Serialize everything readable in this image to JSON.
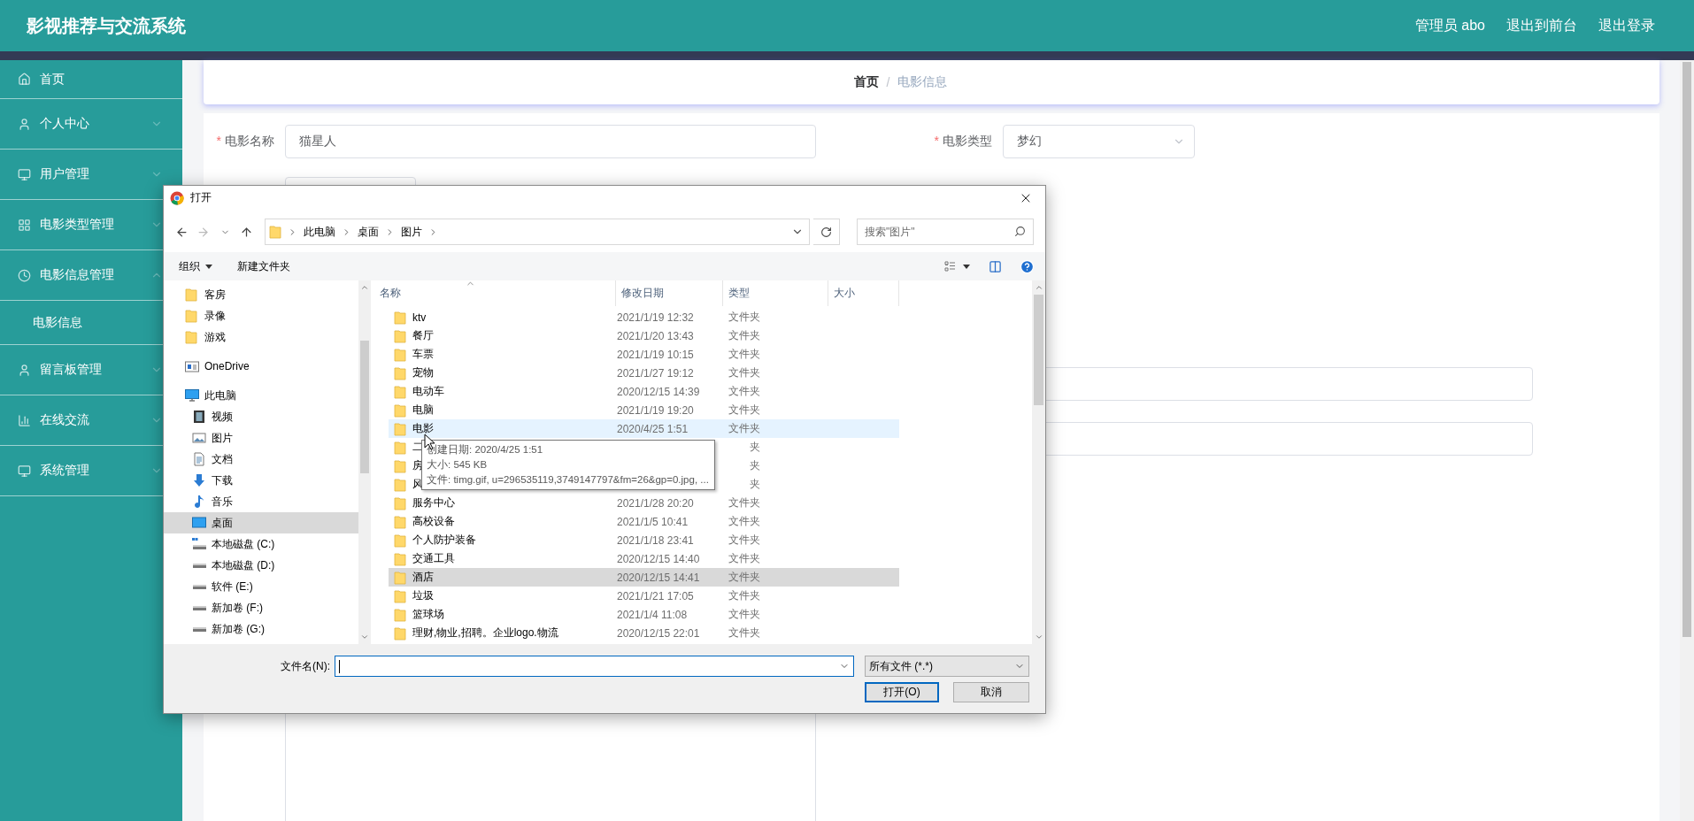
{
  "header": {
    "title": "影视推荐与交流系统",
    "links": [
      "管理员 abo",
      "退出到前台",
      "退出登录"
    ]
  },
  "sidebar": {
    "items": [
      {
        "kind": "home",
        "label": "首页"
      },
      {
        "kind": "user",
        "label": "个人中心",
        "expanded": false
      },
      {
        "kind": "monitor",
        "label": "用户管理",
        "expanded": false
      },
      {
        "kind": "grid",
        "label": "电影类型管理",
        "expanded": false
      },
      {
        "kind": "clock",
        "label": "电影信息管理",
        "expanded": true,
        "children": [
          {
            "label": "电影信息"
          }
        ]
      },
      {
        "kind": "user",
        "label": "留言板管理",
        "expanded": false
      },
      {
        "kind": "bars",
        "label": "在线交流",
        "expanded": false
      },
      {
        "kind": "monitor",
        "label": "系统管理",
        "expanded": false
      }
    ]
  },
  "breadcrumb": {
    "items": [
      "首页",
      "电影信息"
    ],
    "separator": "/"
  },
  "form": {
    "fields": [
      {
        "kind": "input",
        "label": "电影名称",
        "required_mark": "*",
        "value": "猫星人"
      },
      {
        "kind": "select",
        "label": "电影类型",
        "required_mark": "*",
        "value": "梦幻"
      }
    ]
  },
  "dialog": {
    "title": "打开",
    "address": [
      "此电脑",
      "桌面",
      "图片"
    ],
    "search_placeholder": "搜索\"图片\"",
    "toolbar": {
      "organize": "组织",
      "new_folder": "新建文件夹"
    },
    "nav_pane": {
      "items": [
        {
          "kind": "folder",
          "label": "客房",
          "selected": false
        },
        {
          "kind": "folder",
          "label": "录像",
          "selected": false
        },
        {
          "kind": "folder",
          "label": "游戏",
          "selected": false
        },
        {
          "kind": "onedrive",
          "label": "OneDrive",
          "selected": false
        },
        {
          "kind": "pc",
          "label": "此电脑",
          "selected": false,
          "children": [
            {
              "kind": "video",
              "label": "视频",
              "selected": false
            },
            {
              "kind": "pictures",
              "label": "图片",
              "selected": false
            },
            {
              "kind": "documents",
              "label": "文档",
              "selected": false
            },
            {
              "kind": "downloads",
              "label": "下载",
              "selected": false
            },
            {
              "kind": "music",
              "label": "音乐",
              "selected": false
            },
            {
              "kind": "desktop",
              "label": "桌面",
              "selected": true
            },
            {
              "kind": "system-drive",
              "label": "本地磁盘 (C:)",
              "selected": false
            },
            {
              "kind": "drive",
              "label": "本地磁盘 (D:)",
              "selected": false
            },
            {
              "kind": "drive",
              "label": "软件 (E:)",
              "selected": false
            },
            {
              "kind": "drive",
              "label": "新加卷 (F:)",
              "selected": false
            },
            {
              "kind": "drive",
              "label": "新加卷 (G:)",
              "selected": false
            }
          ]
        }
      ]
    },
    "columns": [
      "名称",
      "修改日期",
      "类型",
      "大小"
    ],
    "rows": [
      {
        "name": "ktv",
        "date": "2021/1/19 12:32",
        "type": "文件夹",
        "selected": false,
        "hovered": false
      },
      {
        "name": "餐厅",
        "date": "2021/1/20 13:43",
        "type": "文件夹",
        "selected": false,
        "hovered": false
      },
      {
        "name": "车票",
        "date": "2021/1/19 10:15",
        "type": "文件夹",
        "selected": false,
        "hovered": false
      },
      {
        "name": "宠物",
        "date": "2021/1/27 19:12",
        "type": "文件夹",
        "selected": false,
        "hovered": false
      },
      {
        "name": "电动车",
        "date": "2020/12/15 14:39",
        "type": "文件夹",
        "selected": false,
        "hovered": false
      },
      {
        "name": "电脑",
        "date": "2021/1/19 19:20",
        "type": "文件夹",
        "selected": false,
        "hovered": false
      },
      {
        "name": "电影",
        "date": "2020/4/25 1:51",
        "type": "文件夹",
        "selected": false,
        "hovered": true
      },
      {
        "name": "二",
        "type": "夹",
        "selected": false,
        "hovered": false
      },
      {
        "name": "房",
        "type": "夹",
        "selected": false,
        "hovered": false
      },
      {
        "name": "风",
        "type": "夹",
        "selected": false,
        "hovered": false
      },
      {
        "name": "服务中心",
        "date": "2021/1/28 20:20",
        "type": "文件夹",
        "selected": false,
        "hovered": false
      },
      {
        "name": "高校设备",
        "date": "2021/1/5 10:41",
        "type": "文件夹",
        "selected": false,
        "hovered": false
      },
      {
        "name": "个人防护装备",
        "date": "2021/1/18 23:41",
        "type": "文件夹",
        "selected": false,
        "hovered": false
      },
      {
        "name": "交通工具",
        "date": "2020/12/15 14:40",
        "type": "文件夹",
        "selected": false,
        "hovered": false
      },
      {
        "name": "酒店",
        "date": "2020/12/15 14:41",
        "type": "文件夹",
        "selected": true,
        "hovered": false
      },
      {
        "name": "垃圾",
        "date": "2021/1/21 17:05",
        "type": "文件夹",
        "selected": false,
        "hovered": false
      },
      {
        "name": "篮球场",
        "date": "2021/1/4 11:08",
        "type": "文件夹",
        "selected": false,
        "hovered": false
      },
      {
        "name": "理财,物业,招聘。企业logo.物流",
        "date": "2020/12/15 22:01",
        "type": "文件夹",
        "selected": false,
        "hovered": false
      }
    ],
    "tooltip": {
      "lines": [
        "创建日期: 2020/4/25 1:51",
        "大小: 545 KB",
        "文件: timg.gif, u=296535119,3749147797&fm=26&gp=0.jpg, ..."
      ]
    },
    "filename_label": "文件名(N):",
    "filter": "所有文件 (*.*)",
    "buttons": [
      "打开(O)",
      "取消"
    ]
  }
}
